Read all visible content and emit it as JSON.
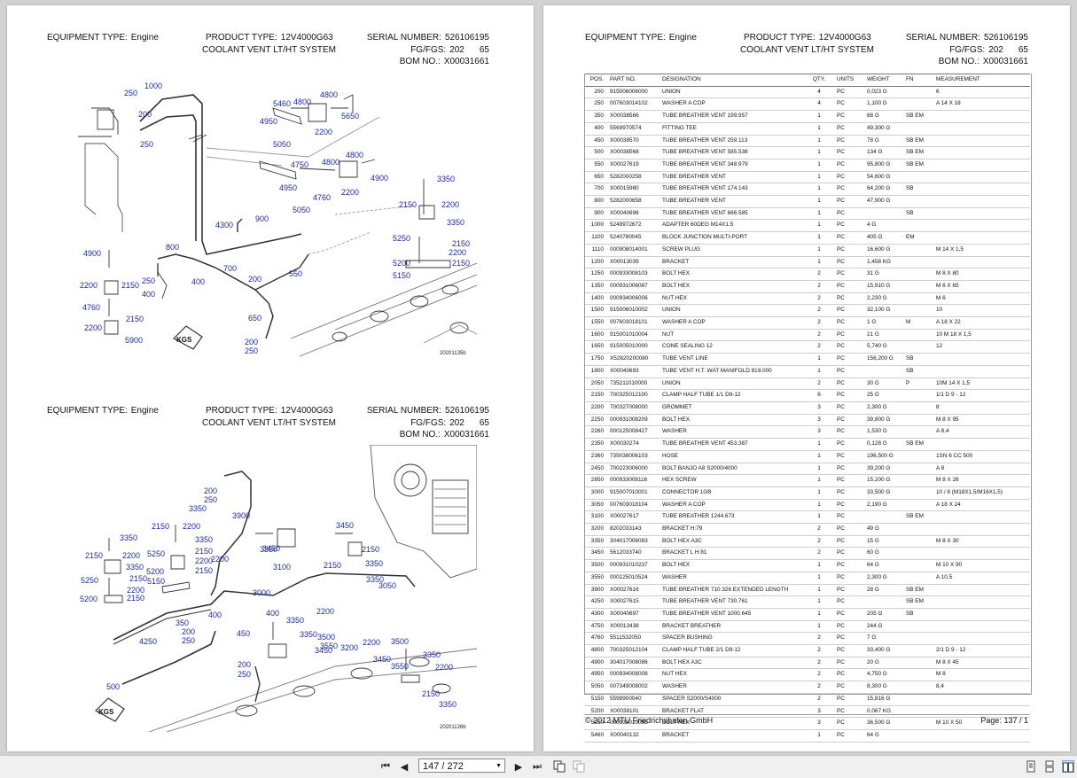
{
  "header": {
    "equipment_type_label": "EQUIPMENT TYPE:",
    "equipment_type_value": "Engine",
    "product_type_label": "PRODUCT TYPE:",
    "product_type_value": "12V4000G63",
    "system_name": "COOLANT VENT LT/HT SYSTEM",
    "serial_number_label": "SERIAL NUMBER:",
    "serial_number_value": "526106195",
    "fg_label": "FG/FGS:",
    "fg_value": "202",
    "fgs_value": "65",
    "bom_label": "BOM NO.:",
    "bom_value": "X00031661"
  },
  "figures": {
    "top_id": "20201135b",
    "bottom_id": "20201126b",
    "badge": "KGS",
    "top_callouts": [
      "1000",
      "250",
      "200",
      "250",
      "5460",
      "4800",
      "5650",
      "4950",
      "4800",
      "2200",
      "5050",
      "4750",
      "4800",
      "4800",
      "4900",
      "4950",
      "2200",
      "4760",
      "5050",
      "900",
      "4300",
      "3350",
      "2150",
      "2200",
      "3350",
      "5250",
      "2150",
      "2200",
      "5200",
      "2150",
      "5150",
      "4900",
      "800",
      "700",
      "550",
      "2200",
      "2150",
      "400",
      "200",
      "250",
      "400",
      "4760",
      "2150",
      "2200",
      "5900",
      "650",
      "200",
      "250"
    ],
    "bottom_callouts": [
      "200",
      "250",
      "3350",
      "3900",
      "2150",
      "2200",
      "3350",
      "3350",
      "2150",
      "5250",
      "2200",
      "2150",
      "3350",
      "2200",
      "2150",
      "5200",
      "5150",
      "2150",
      "5250",
      "2200",
      "5200",
      "2150",
      "350",
      "400",
      "200",
      "250",
      "4250",
      "450",
      "3450",
      "2150",
      "3350",
      "2200",
      "3350",
      "3450",
      "2150",
      "3350",
      "3050",
      "3000",
      "3100",
      "400",
      "3350",
      "2200",
      "3500",
      "3350",
      "3550",
      "3450",
      "3200",
      "2200",
      "3500",
      "3350",
      "3450",
      "2200",
      "3550",
      "200",
      "250",
      "500",
      "2150",
      "3350"
    ]
  },
  "table": {
    "columns": [
      "POS.",
      "PART NO.",
      "DESIGNATION",
      "QTY.",
      "UNITS",
      "WEIGHT",
      "FN",
      "MEASUREMENT"
    ],
    "rows": [
      [
        "200",
        "915006006000",
        "UNION",
        "4",
        "PC",
        "0,023 G",
        "",
        "6"
      ],
      [
        "250",
        "007603014102",
        "WASHER A COP",
        "4",
        "PC",
        "1,100 G",
        "",
        "A 14 X 18"
      ],
      [
        "350",
        "X00038566",
        "TUBE BREATHER VENT 199.957",
        "1",
        "PC",
        "68 G",
        "SB EM",
        ""
      ],
      [
        "400",
        "5569970574",
        "FITTING TEE",
        "1",
        "PC",
        "49,300 G",
        "",
        ""
      ],
      [
        "450",
        "X00038570",
        "TUBE BREATHER VENT 259.113",
        "1",
        "PC",
        "78 G",
        "SB EM",
        ""
      ],
      [
        "500",
        "X00038568",
        "TUBE BREATHER VENT 585.538",
        "1",
        "PC",
        "134 G",
        "SB EM",
        ""
      ],
      [
        "550",
        "X00027619",
        "TUBE BREATHER VENT 348.979",
        "1",
        "PC",
        "95,800 G",
        "SB EM",
        ""
      ],
      [
        "650",
        "5282000258",
        "TUBE BREATHER VENT",
        "1",
        "PC",
        "54,600 G",
        "",
        ""
      ],
      [
        "700",
        "X00015980",
        "TUBE BREATHER VENT 174.143",
        "1",
        "PC",
        "64,200 G",
        "SB",
        ""
      ],
      [
        "800",
        "5282000658",
        "TUBE BREATHER VENT",
        "1",
        "PC",
        "47,900 G",
        "",
        ""
      ],
      [
        "900",
        "X00040696",
        "TUBE BREATHER VENT 686.585",
        "1",
        "PC",
        "",
        "SB",
        ""
      ],
      [
        "1000",
        "5249972672",
        "ADAPTER 60DEG M14X1.5",
        "1",
        "PC",
        "4 G",
        "",
        ""
      ],
      [
        "1100",
        "5240780045",
        "BLOCK JUNCTION MULTI-PORT",
        "1",
        "PC",
        "405 G",
        "EM",
        ""
      ],
      [
        "1110",
        "000908014001",
        "SCREW PLUG",
        "1",
        "PC",
        "16,600 G",
        "",
        "M 14 X 1,5"
      ],
      [
        "1200",
        "X00013039",
        "BRACKET",
        "1",
        "PC",
        "1,458 KG",
        "",
        ""
      ],
      [
        "1250",
        "000933008103",
        "BOLT HEX",
        "2",
        "PC",
        "31 G",
        "",
        "M 8 X 80"
      ],
      [
        "1350",
        "000931006087",
        "BOLT HEX",
        "2",
        "PC",
        "15,910 G",
        "",
        "M 6 X 65"
      ],
      [
        "1400",
        "000934006006",
        "NUT HEX",
        "2",
        "PC",
        "2,230 G",
        "",
        "M 6"
      ],
      [
        "1500",
        "915006010002",
        "UNION",
        "2",
        "PC",
        "32,100 G",
        "",
        "10"
      ],
      [
        "1550",
        "007603018101",
        "WASHER A COP",
        "2",
        "PC",
        "1 G",
        "M",
        "A 18 X 22"
      ],
      [
        "1600",
        "915001010004",
        "NUT",
        "2",
        "PC",
        "21 G",
        "",
        "10 M 18 X 1,5"
      ],
      [
        "1650",
        "915005010000",
        "CONE SEALING 12",
        "2",
        "PC",
        "5,740 G",
        "",
        "12"
      ],
      [
        "1750",
        "X52820200080",
        "TUBE VENT LINE",
        "1",
        "PC",
        "156,200 G",
        "SB",
        ""
      ],
      [
        "1800",
        "X00040693",
        "TUBE VENT H.T. WAT MANIFOLD 819.000",
        "1",
        "PC",
        "",
        "SB",
        ""
      ],
      [
        "2050",
        "735211010000",
        "UNION",
        "2",
        "PC",
        "30 G",
        "P",
        "10M 14 X 1,5"
      ],
      [
        "2150",
        "700325012100",
        "CLAMP HALF TUBE 1/1 D9-12",
        "6",
        "PC",
        "25 G",
        "",
        "1/1 D 9 - 12"
      ],
      [
        "2200",
        "700327008000",
        "GROMMET",
        "3",
        "PC",
        "2,300 G",
        "",
        "8"
      ],
      [
        "2250",
        "000931008209",
        "BOLT HEX",
        "3",
        "PC",
        "39,800 G",
        "",
        "M 8 X 95"
      ],
      [
        "2260",
        "000125008427",
        "WASHER",
        "3",
        "PC",
        "1,530 G",
        "",
        "A 8,4"
      ],
      [
        "2350",
        "X00030274",
        "TUBE BREATHER VENT 453.387",
        "1",
        "PC",
        "0,128 G",
        "SB EM",
        ""
      ],
      [
        "2360",
        "735038006103",
        "HOSE",
        "1",
        "PC",
        "196,500 G",
        "",
        "1SN 6 CC 500"
      ],
      [
        "2450",
        "700223006000",
        "BOLT BANJO A8 S2000/4000",
        "1",
        "PC",
        "39,200 G",
        "",
        "A 8"
      ],
      [
        "2850",
        "000933008116",
        "HEX SCREW",
        "1",
        "PC",
        "15,200 G",
        "",
        "M 8 X 28"
      ],
      [
        "3000",
        "915007010001",
        "CONNECTOR 10/8",
        "1",
        "PC",
        "33,500 G",
        "",
        "10 / 8 (M18X1,5/M16X1,5)"
      ],
      [
        "3050",
        "007603018104",
        "WASHER A COP",
        "1",
        "PC",
        "2,190 G",
        "",
        "A 18 X 24"
      ],
      [
        "3100",
        "X00027617",
        "TUBE BREATHER 1244.673",
        "1",
        "PC",
        "",
        "SB EM",
        ""
      ],
      [
        "3200",
        "8202033143",
        "BRACKET H:79",
        "2",
        "PC",
        "49 G",
        "",
        ""
      ],
      [
        "3350",
        "304017008083",
        "BOLT HEX A3C",
        "2",
        "PC",
        "15 G",
        "",
        "M 8 X 30"
      ],
      [
        "3450",
        "5612033740",
        "BRACKET L H:81",
        "2",
        "PC",
        "60 G",
        "",
        ""
      ],
      [
        "3500",
        "000931010237",
        "BOLT HEX",
        "1",
        "PC",
        "64 G",
        "",
        "M 10 X 90"
      ],
      [
        "3550",
        "000125010524",
        "WASHER",
        "1",
        "PC",
        "2,300 G",
        "",
        "A 10,5"
      ],
      [
        "3900",
        "X00027616",
        "TUBE BREATHER 710.326 EXTENDED LENGTH",
        "1",
        "PC",
        "28 G",
        "SB EM",
        ""
      ],
      [
        "4250",
        "X00027615",
        "TUBE BREATHER VENT 730.761",
        "1",
        "PC",
        "",
        "SB EM",
        ""
      ],
      [
        "4300",
        "X00040697",
        "TUBE BREATHER VENT 1000.645",
        "1",
        "PC",
        "205 G",
        "SB",
        ""
      ],
      [
        "4750",
        "X00013438",
        "BRACKET BREATHER",
        "1",
        "PC",
        "244 G",
        "",
        ""
      ],
      [
        "4760",
        "5511532050",
        "SPACER BUSHING",
        "2",
        "PC",
        "7 G",
        "",
        ""
      ],
      [
        "4800",
        "700325012104",
        "CLAMP HALF TUBE 2/1 D9-12",
        "2",
        "PC",
        "33,400 G",
        "",
        "2/1 D 9 - 12"
      ],
      [
        "4900",
        "304017008086",
        "BOLT HEX A3C",
        "2",
        "PC",
        "20 G",
        "",
        "M 8 X 45"
      ],
      [
        "4950",
        "000934008008",
        "NUT HEX",
        "2",
        "PC",
        "4,750 G",
        "",
        "M 8"
      ],
      [
        "5050",
        "007349008002",
        "WASHER",
        "2",
        "PC",
        "8,300 G",
        "",
        "8,4"
      ],
      [
        "5150",
        "5599900040",
        "SPACER S2000/S4000",
        "2",
        "PC",
        "15,816 G",
        "",
        ""
      ],
      [
        "5200",
        "X00038101",
        "BRACKET FLAT",
        "3",
        "PC",
        "0,067 KG",
        "",
        ""
      ],
      [
        "5250",
        "000933010095",
        "BOLT HEX",
        "3",
        "PC",
        "36,500 G",
        "",
        "M 10 X 50"
      ],
      [
        "5460",
        "X00040132",
        "BRACKET",
        "1",
        "PC",
        "64 G",
        "",
        ""
      ]
    ]
  },
  "footer": {
    "copyright": "© 2012 MTU Friedrichshafen GmbH",
    "page_label": "Page:",
    "page_value": "137 / 1"
  },
  "toolbar": {
    "page_indicator": "147 / 272"
  },
  "colors": {
    "callout": "#1d2a9c",
    "viewer_bg": "#d2d2d2",
    "toolbar_bg": "#f0f0f0"
  }
}
